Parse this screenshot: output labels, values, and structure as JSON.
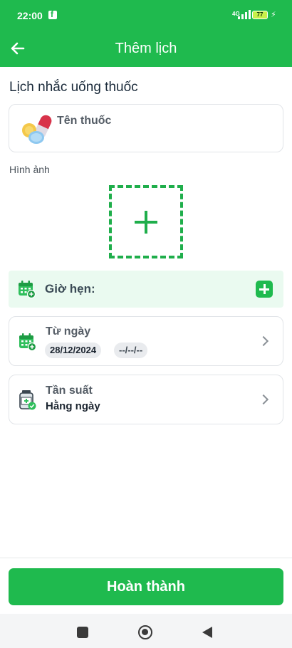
{
  "status_bar": {
    "time": "22:00",
    "network": "4G",
    "battery": "77"
  },
  "header": {
    "title": "Thêm lịch"
  },
  "section_title": "Lịch nhắc uống thuốc",
  "medicine": {
    "placeholder": "Tên thuốc"
  },
  "image_section": {
    "label": "Hình ảnh"
  },
  "reminder_time": {
    "label": "Giờ hẹn:"
  },
  "date_range": {
    "label": "Từ ngày",
    "start_date": "28/12/2024",
    "end_date": "--/--/--"
  },
  "frequency": {
    "label": "Tần suất",
    "value": "Hằng ngày"
  },
  "footer": {
    "submit_label": "Hoàn thành"
  },
  "colors": {
    "primary": "#1fba4e",
    "highlight_bg": "#eafaf0"
  }
}
